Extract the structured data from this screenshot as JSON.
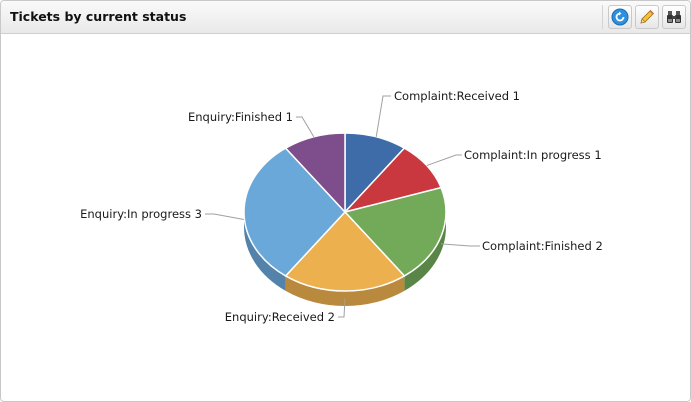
{
  "panel": {
    "title": "Tickets by current status",
    "tools": [
      {
        "name": "refresh-icon"
      },
      {
        "name": "edit-icon"
      },
      {
        "name": "binoculars-icon"
      }
    ]
  },
  "chart_data": {
    "type": "pie",
    "title": "",
    "slices": [
      {
        "label": "Complaint:Received 1",
        "value": 1,
        "color": "#3e6ca9"
      },
      {
        "label": "Complaint:In progress 1",
        "value": 1,
        "color": "#c9383e"
      },
      {
        "label": "Complaint:Finished 2",
        "value": 2,
        "color": "#72aa5a"
      },
      {
        "label": "Enquiry:Received 2",
        "value": 2,
        "color": "#edb04f"
      },
      {
        "label": "Enquiry:In progress 3",
        "value": 3,
        "color": "#6ba8da"
      },
      {
        "label": "Enquiry:Finished 1",
        "value": 1,
        "color": "#7e4e8c"
      }
    ]
  }
}
